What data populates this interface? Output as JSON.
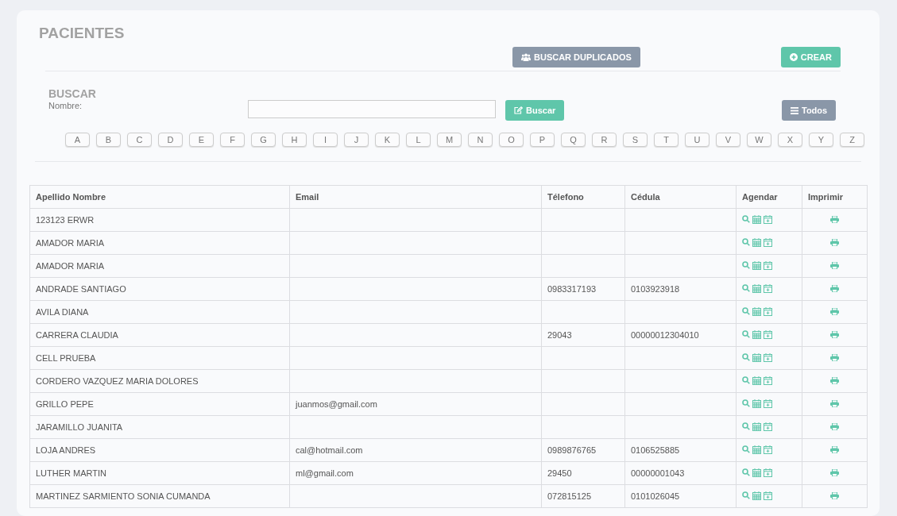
{
  "title": "PACIENTES",
  "toolbar": {
    "duplicates_button": "BUSCAR DUPLICADOS",
    "create_button": "CREAR"
  },
  "search": {
    "heading": "BUSCAR",
    "name_label": "Nombre:",
    "search_button": "Buscar",
    "all_button": "Todos"
  },
  "letters": [
    "A",
    "B",
    "C",
    "D",
    "E",
    "F",
    "G",
    "H",
    "I",
    "J",
    "K",
    "L",
    "M",
    "N",
    "O",
    "P",
    "Q",
    "R",
    "S",
    "T",
    "U",
    "V",
    "W",
    "X",
    "Y",
    "Z"
  ],
  "table": {
    "columns": [
      "Apellido Nombre",
      "Email",
      "Télefono",
      "Cédula",
      "Agendar",
      "Imprimir"
    ],
    "rows": [
      {
        "name": "123123 ERWR"
      },
      {
        "name": "AMADOR MARIA"
      },
      {
        "name": "AMADOR MARIA"
      },
      {
        "name": "ANDRADE SANTIAGO",
        "phone": "0983317193",
        "id": "0103923918"
      },
      {
        "name": "AVILA DIANA"
      },
      {
        "name": "CARRERA CLAUDIA",
        "phone": "29043",
        "id": "00000012304010"
      },
      {
        "name": "CELL PRUEBA"
      },
      {
        "name": "CORDERO VAZQUEZ MARIA DOLORES"
      },
      {
        "name": "GRILLO PEPE",
        "email": "juanmos@gmail.com"
      },
      {
        "name": "JARAMILLO JUANITA"
      },
      {
        "name": "LOJA ANDRES",
        "email": "cal@hotmail.com",
        "phone": "0989876765",
        "id": "0106525885"
      },
      {
        "name": "LUTHER MARTIN",
        "email": "ml@gmail.com",
        "phone": "29450",
        "id": "00000001043"
      },
      {
        "name": "MARTINEZ SARMIENTO SONIA CUMANDA",
        "phone": "072815125",
        "id": "0101026045"
      }
    ]
  }
}
